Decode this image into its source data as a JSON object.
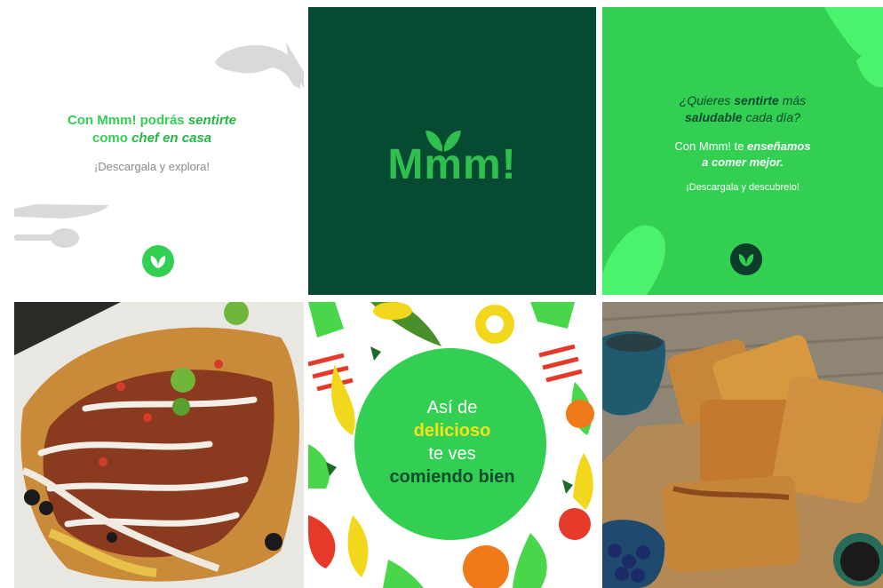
{
  "tile1": {
    "line1_start": "Con Mmm! podrás ",
    "line1_emph": "sentirte",
    "line2_start": "como ",
    "line2_emph": "chef en casa",
    "cta": "¡Descargala y explora!",
    "icons": [
      "chef-silhouette-icon",
      "knife-icon",
      "spoon-icon",
      "leaf-badge-icon"
    ]
  },
  "tile2": {
    "logo_text": "Mmm!",
    "logo_icon": "leaf-sprout-icon",
    "background": "#074a32",
    "logo_color": "#2fbf4e"
  },
  "tile3": {
    "q_line1_a": "¿Quieres ",
    "q_line1_emph": "sentirte",
    "q_line1_b": " más",
    "q_line2_emph": "saludable",
    "q_line2_b": " cada día?",
    "body_line1_a": "Con Mmm! te ",
    "body_line1_emph": "enseñamos",
    "body_line2_emph": "a comer mejor.",
    "cta": "¡Descargala y descubrelo!",
    "background": "#33cf53"
  },
  "tile4": {
    "photo": "nachos-photo"
  },
  "tile5": {
    "line1": "Así de",
    "line2": "delicioso",
    "line3": "te ves",
    "line4": "comiendo bien",
    "circle_color": "#33cf53",
    "highlight_color": "#f5e21a"
  },
  "tile6": {
    "photo": "french-toast-photo"
  },
  "colors": {
    "brand_green": "#33cf53",
    "dark_green": "#074a32"
  }
}
